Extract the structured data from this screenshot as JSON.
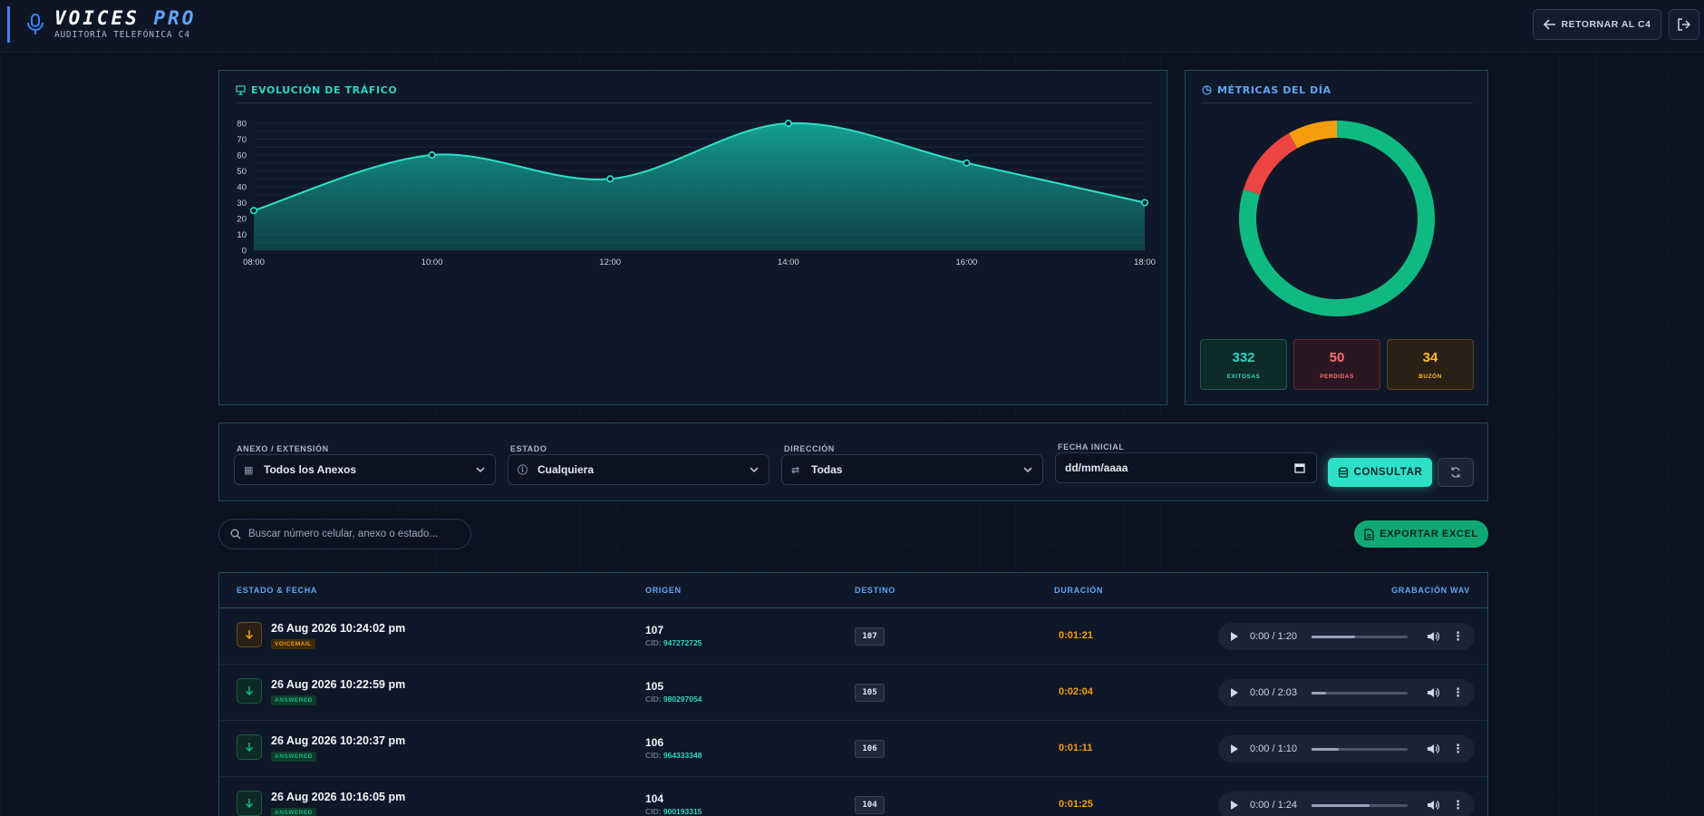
{
  "header": {
    "brand_main": "VOICES",
    "brand_accent": "PRO",
    "subtitle": "AUDITORÍA TELEFÓNICA C4",
    "return_label": "RETORNAR AL C4",
    "icons": {
      "mic": "microphone-icon",
      "return": "arrow-left-icon",
      "logout": "logout-icon"
    }
  },
  "traffic": {
    "title": "EVOLUCIÓN DE TRÁFICO",
    "icon": "monitor-icon"
  },
  "chart_data": {
    "type": "area",
    "x": [
      "08:00",
      "10:00",
      "12:00",
      "14:00",
      "16:00",
      "18:00"
    ],
    "values": [
      25,
      60,
      45,
      80,
      55,
      30
    ],
    "yticks": [
      0,
      10,
      20,
      30,
      40,
      50,
      60,
      70,
      80
    ],
    "ylim": [
      0,
      80
    ],
    "grid": true,
    "title": "",
    "xlabel": "",
    "ylabel": "",
    "color": "#2de0c8"
  },
  "metrics": {
    "title": "MÉTRICAS DEL DÍA",
    "icon": "pie-chart-icon",
    "donut": {
      "type": "pie",
      "slices": [
        {
          "label": "EXITOSAS",
          "value": 332,
          "color": "#10b981"
        },
        {
          "label": "PERDIDAS",
          "value": 50,
          "color": "#ef4444"
        },
        {
          "label": "BUZÓN",
          "value": 34,
          "color": "#f59e0b"
        }
      ]
    },
    "stats": [
      {
        "value": "332",
        "label": "EXITOSAS"
      },
      {
        "value": "50",
        "label": "PERDIDAS"
      },
      {
        "value": "34",
        "label": "BUZÓN"
      }
    ]
  },
  "filters": {
    "anexo": {
      "label": "ANEXO / EXTENSIÓN",
      "value": "Todos los Anexos",
      "icon": "building-icon"
    },
    "estado": {
      "label": "ESTADO",
      "value": "Cualquiera",
      "icon": "info-circle-icon"
    },
    "direccion": {
      "label": "DIRECCIÓN",
      "value": "Todas",
      "icon": "swap-arrows-icon"
    },
    "fecha": {
      "label": "FECHA INICIAL",
      "value": "dd/mm/aaaa",
      "icon": "calendar-icon"
    },
    "consultar_label": "CONSULTAR"
  },
  "search": {
    "placeholder": "Buscar número celular, anexo o estado..."
  },
  "export_label": "EXPORTAR EXCEL",
  "table": {
    "headers": [
      "ESTADO & FECHA",
      "ORIGEN",
      "DESTINO",
      "DURACIÓN",
      "GRABACIÓN WAV"
    ],
    "cid_prefix": "CID:",
    "rows": [
      {
        "date": "26 Aug 2026 10:24:02 pm",
        "status": "VOICEMAIL",
        "origin": "107",
        "cid": "947272725",
        "dest": "107",
        "duration": "0:01:21",
        "audio_time": "0:00 / 1:20",
        "progress": 0.45
      },
      {
        "date": "26 Aug 2026 10:22:59 pm",
        "status": "ANSWERED",
        "origin": "105",
        "cid": "980297054",
        "dest": "105",
        "duration": "0:02:04",
        "audio_time": "0:00 / 2:03",
        "progress": 0.15
      },
      {
        "date": "26 Aug 2026 10:20:37 pm",
        "status": "ANSWERED",
        "origin": "106",
        "cid": "964333348",
        "dest": "106",
        "duration": "0:01:11",
        "audio_time": "0:00 / 1:10",
        "progress": 0.28
      },
      {
        "date": "26 Aug 2026 10:16:05 pm",
        "status": "ANSWERED",
        "origin": "104",
        "cid": "900193315",
        "dest": "104",
        "duration": "0:01:25",
        "audio_time": "0:00 / 1:24",
        "progress": 0.6
      }
    ]
  }
}
